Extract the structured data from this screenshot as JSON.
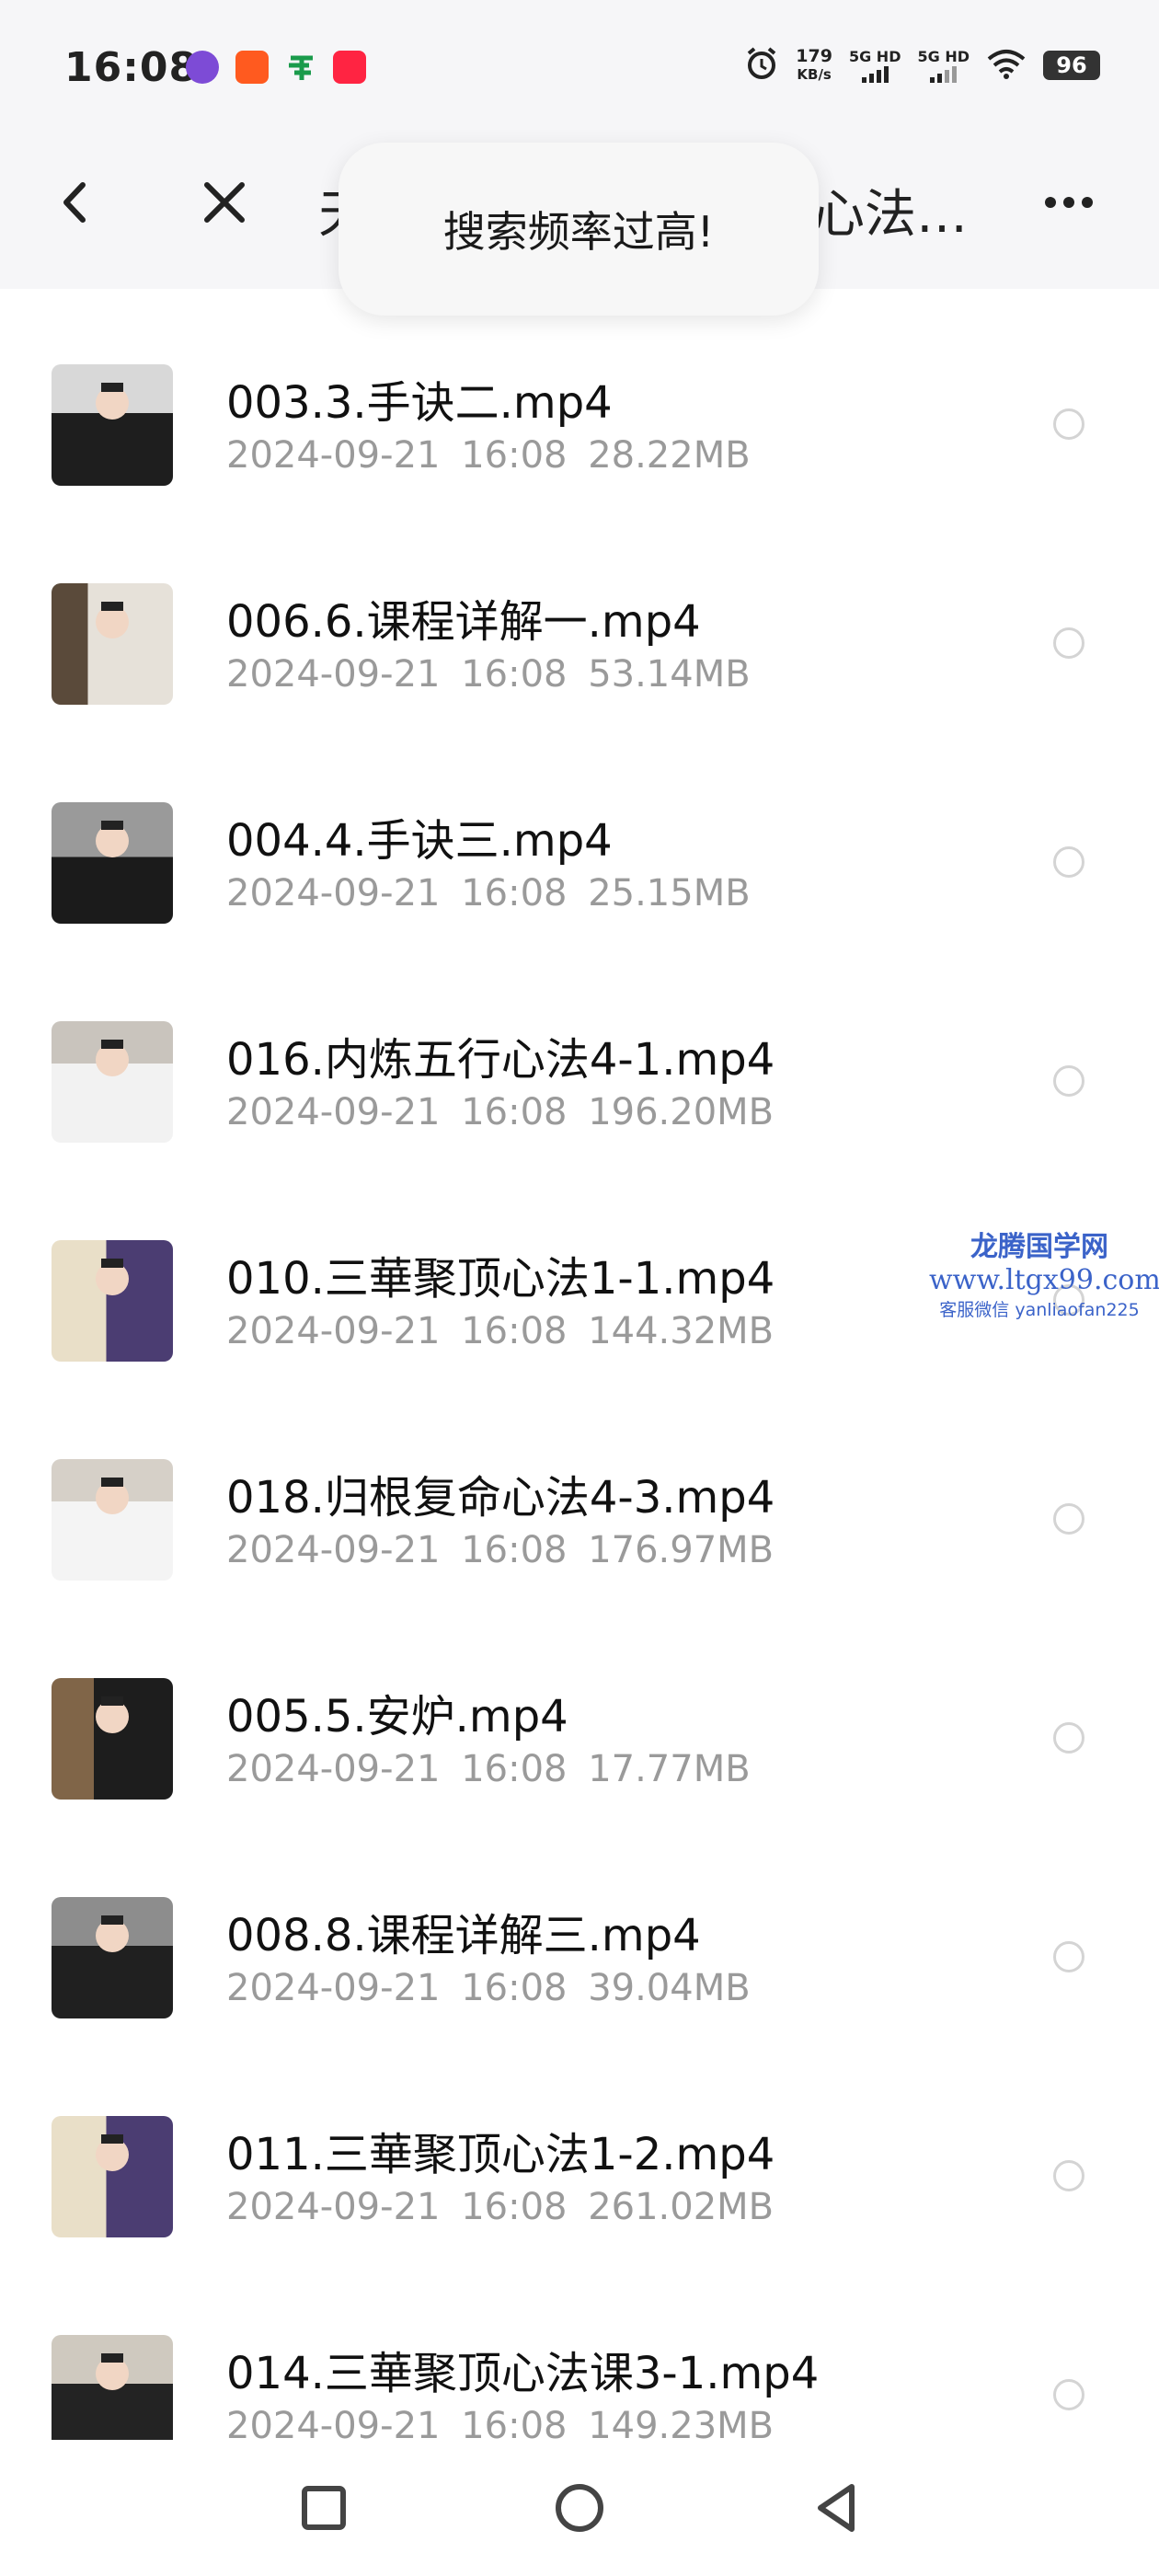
{
  "status_bar": {
    "time": "16:08",
    "net_speed_value": "179",
    "net_speed_unit": "KB/s",
    "sim1_label": "5G HD",
    "sim2_label": "5G HD",
    "battery": "96",
    "icons": [
      "app-icon-infinity",
      "taobao-icon",
      "post-icon",
      "xiaohongshu-icon",
      "alarm-icon",
      "signal-icon",
      "wifi-icon",
      "battery-icon"
    ]
  },
  "header": {
    "title_partial_left": "天",
    "title_partial_right": "心法…",
    "icons": [
      "back-icon",
      "close-icon",
      "more-icon"
    ]
  },
  "toast": {
    "message": "搜索频率过高!"
  },
  "files": [
    {
      "name": "003.3.手诀二.mp4",
      "date": "2024-09-21",
      "time": "16:08",
      "size": "28.22MB"
    },
    {
      "name": "006.6.课程详解一.mp4",
      "date": "2024-09-21",
      "time": "16:08",
      "size": "53.14MB"
    },
    {
      "name": "004.4.手诀三.mp4",
      "date": "2024-09-21",
      "time": "16:08",
      "size": "25.15MB"
    },
    {
      "name": "016.内炼五行心法4-1.mp4",
      "date": "2024-09-21",
      "time": "16:08",
      "size": "196.20MB"
    },
    {
      "name": "010.三華聚顶心法1-1.mp4",
      "date": "2024-09-21",
      "time": "16:08",
      "size": "144.32MB"
    },
    {
      "name": "018.归根复命心法4-3.mp4",
      "date": "2024-09-21",
      "time": "16:08",
      "size": "176.97MB"
    },
    {
      "name": "005.5.安炉.mp4",
      "date": "2024-09-21",
      "time": "16:08",
      "size": "17.77MB"
    },
    {
      "name": "008.8.课程详解三.mp4",
      "date": "2024-09-21",
      "time": "16:08",
      "size": "39.04MB"
    },
    {
      "name": "011.三華聚顶心法1-2.mp4",
      "date": "2024-09-21",
      "time": "16:08",
      "size": "261.02MB"
    },
    {
      "name": "014.三華聚顶心法课3-1.mp4",
      "date": "2024-09-21",
      "time": "16:08",
      "size": "149.23MB"
    }
  ],
  "watermark": {
    "line1": "龙腾国学网",
    "line2": "www.ltgx99.com",
    "line3": "客服微信 yanliaofan225"
  },
  "bottom_nav": {
    "icons": [
      "recents-icon",
      "home-icon",
      "back-triangle-icon"
    ]
  },
  "colors": {
    "background": "#ffffff",
    "header_bg": "#f6f6f8",
    "meta_text": "#9a9a9a",
    "watermark": "#3b63c9"
  }
}
